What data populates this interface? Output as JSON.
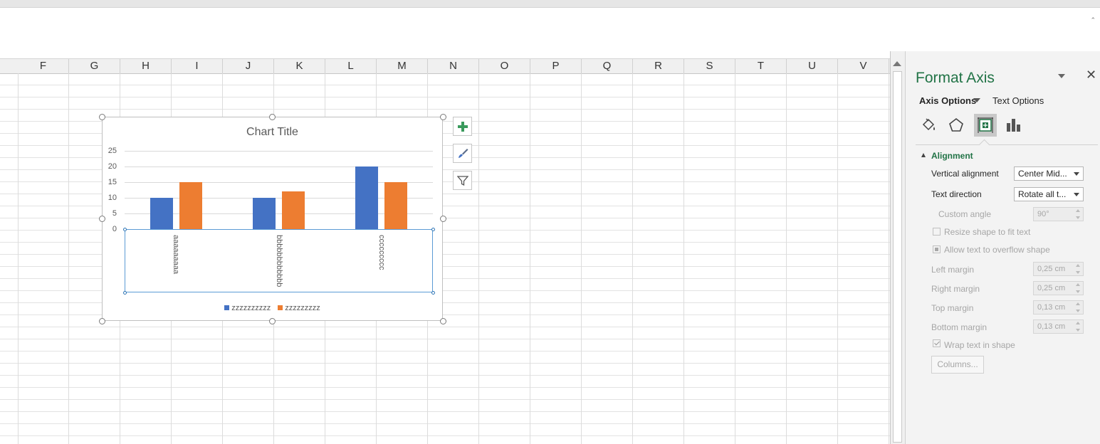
{
  "columns": [
    "F",
    "G",
    "H",
    "I",
    "J",
    "K",
    "L",
    "M",
    "N",
    "O",
    "P",
    "Q",
    "R",
    "S",
    "T",
    "U",
    "V"
  ],
  "chart": {
    "title": "Chart Title",
    "buttons": [
      "chart-elements-plus-icon",
      "chart-styles-brush-icon",
      "chart-filters-funnel-icon"
    ]
  },
  "chart_data": {
    "type": "bar",
    "title": "Chart Title",
    "categories": [
      "aaaaaaaaa",
      "bbbbbbbbbbbb",
      "ccccccccc"
    ],
    "series": [
      {
        "name": "zzzzzzzzzz",
        "values": [
          10,
          10,
          20
        ],
        "color": "#4472c4"
      },
      {
        "name": "zzzzzzzzz",
        "values": [
          15,
          12,
          15
        ],
        "color": "#ed7d31"
      }
    ],
    "yticks": [
      "0",
      "5",
      "10",
      "15",
      "20",
      "25"
    ],
    "ylim": [
      0,
      25
    ],
    "grid": true,
    "legend": "bottom"
  },
  "pane": {
    "title": "Format Axis",
    "tab_axis": "Axis Options",
    "tab_text": "Text Options",
    "section": "Alignment",
    "vertical_alignment_label": "Vertical alignment",
    "vertical_alignment_value": "Center Mid...",
    "text_direction_label": "Text direction",
    "text_direction_value": "Rotate all t...",
    "custom_angle_label": "Custom angle",
    "custom_angle_value": "90°",
    "resize_label": "Resize shape to fit text",
    "overflow_label": "Allow text to overflow shape",
    "left_margin_label": "Left margin",
    "left_margin_value": "0,25 cm",
    "right_margin_label": "Right margin",
    "right_margin_value": "0,25 cm",
    "top_margin_label": "Top margin",
    "top_margin_value": "0,13 cm",
    "bottom_margin_label": "Bottom margin",
    "bottom_margin_value": "0,13 cm",
    "wrap_label": "Wrap text in shape",
    "columns_button": "Columns...",
    "accent_color": "#217346",
    "annotation_arrow_color": "#e01010"
  }
}
